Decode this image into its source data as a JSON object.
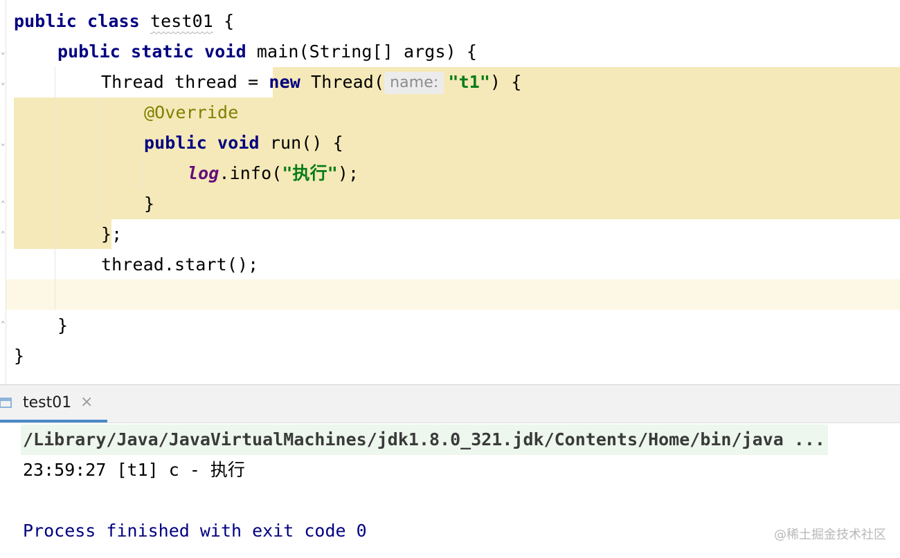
{
  "editor": {
    "line1": {
      "kw": "public class",
      "name": "test01",
      "brace": "{"
    },
    "line2": {
      "kw": "public static void",
      "rest": "main(String[] args) {"
    },
    "line3": {
      "pre": "Thread thread = ",
      "kw_new": "new",
      "ctor": " Thread(",
      "hint": "name:",
      "str": "\"t1\"",
      "post": ") {"
    },
    "line4": {
      "annotation": "@Override"
    },
    "line5": {
      "kw": "public void",
      "rest": " run() {"
    },
    "line6": {
      "log": "log",
      "mid": ".info(",
      "str": "\"执行\"",
      "post": ");"
    },
    "line7": {
      "text": "}"
    },
    "line8": {
      "text": "};"
    },
    "line9": {
      "text": "thread.start();"
    },
    "line11": {
      "text": "}"
    },
    "line12": {
      "text": "}"
    }
  },
  "run_panel": {
    "tab_label": "test01",
    "tab_close": "×",
    "command": "/Library/Java/JavaVirtualMachines/jdk1.8.0_321.jdk/Contents/Home/bin/java ...",
    "log_line": "23:59:27 [t1] c - 执行",
    "exit_line": "Process finished with exit code 0"
  },
  "watermark": "@稀土掘金技术社区",
  "colors": {
    "highlight": "#f5e9b9",
    "keyword": "#000080",
    "string": "#067d17",
    "annotation": "#808000",
    "tab_accent": "#4a88c7"
  }
}
